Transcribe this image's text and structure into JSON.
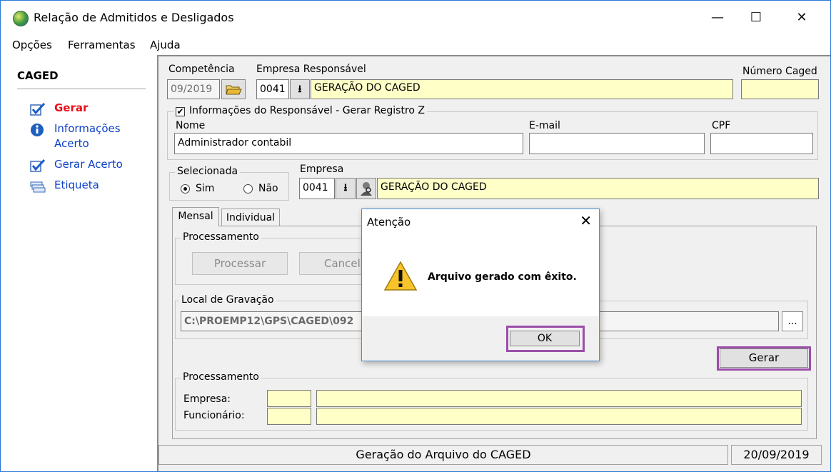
{
  "window": {
    "title": "Relação de Admitidos e Desligados",
    "minimize": "—",
    "maximize": "☐",
    "close": "✕"
  },
  "menu": [
    {
      "label": "Opções"
    },
    {
      "label": "Ferramentas"
    },
    {
      "label": "Ajuda"
    }
  ],
  "sidebar": {
    "title": "CAGED",
    "items": [
      {
        "label": "Gerar",
        "color": "#e8111b",
        "icon": "check-icon"
      },
      {
        "label": "Informações",
        "label2": "Acerto",
        "icon": "info-icon"
      },
      {
        "label": "Gerar Acerto",
        "icon": "check-icon"
      },
      {
        "label": "Etiqueta",
        "icon": "label-icon"
      }
    ]
  },
  "form": {
    "competencia_label": "Competência",
    "competencia_value": "09/2019",
    "empresa_resp_label": "Empresa Responsável",
    "empresa_resp_code": "0041",
    "empresa_resp_name": "GERAÇÃO DO CAGED",
    "numero_caged_label": "Número Caged",
    "numero_caged_value": "",
    "info_resp_label": "Informações do Responsável - Gerar Registro Z",
    "nome_label": "Nome",
    "nome_value": "Administrador contabil",
    "email_label": "E-mail",
    "email_value": "",
    "cpf_label": "CPF",
    "cpf_value": "",
    "selecionada_label": "Selecionada",
    "sim_label": "Sim",
    "nao_label": "Não",
    "empresa_label": "Empresa",
    "empresa_code": "0041",
    "empresa_name": "GERAÇÃO DO CAGED"
  },
  "tabs": [
    {
      "label": "Mensal"
    },
    {
      "label": "Individual"
    }
  ],
  "mensal": {
    "processamento_label": "Processamento",
    "processar_label": "Processar",
    "cancelar_label": "Cancela",
    "local_label": "Local de Gravação",
    "local_value": "C:\\PROEMP12\\GPS\\CAGED\\092",
    "browse_label": "...",
    "gerar_label": "Gerar",
    "proc2_label": "Processamento",
    "empresa_label": "Empresa:",
    "funcionario_label": "Funcionário:"
  },
  "status": {
    "message": "Geração do Arquivo do CAGED",
    "date": "20/09/2019"
  },
  "dialog": {
    "title": "Atenção",
    "close": "✕",
    "message": "Arquivo gerado com êxito.",
    "ok_label": "OK"
  },
  "colors": {
    "highlight": "#9b4fa8",
    "link": "#0b3fc6",
    "field_yellow": "#ffffc8"
  }
}
